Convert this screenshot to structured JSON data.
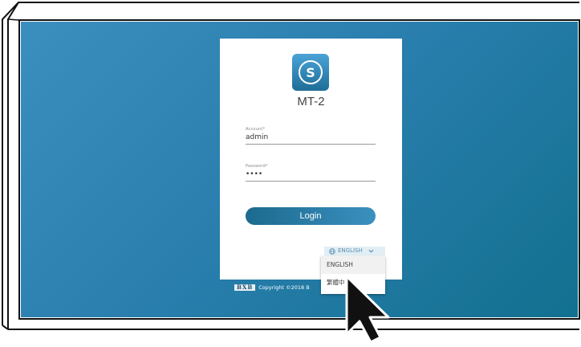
{
  "colors": {
    "background_start": "#3b8fbf",
    "background_end": "#12708f",
    "accent": "#2a7faf",
    "button_start": "#1c6a8e",
    "button_end": "#3a90bf"
  },
  "app": {
    "logo_letter": "S",
    "title": "MT-2"
  },
  "form": {
    "account": {
      "label": "Account*",
      "value": "admin"
    },
    "password": {
      "label": "Password*",
      "value": "••••"
    },
    "login_label": "Login"
  },
  "language": {
    "selected": "ENGLISH",
    "icon": "globe-icon",
    "options": [
      "ENGLISH",
      "繁體中"
    ]
  },
  "footer": {
    "brand": "BXB",
    "copyright": "Copyright ©2018 B"
  },
  "cursor": {
    "icon": "mouse-pointer-icon"
  }
}
